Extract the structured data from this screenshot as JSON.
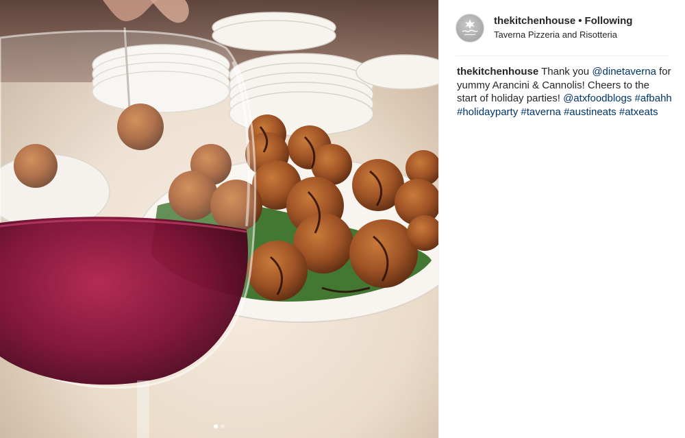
{
  "post": {
    "username": "thekitchenhouse",
    "separator": "•",
    "follow_status": "Following",
    "location": "Taverna Pizzeria and Risotteria"
  },
  "caption": {
    "username": "thekitchenhouse",
    "segments": [
      {
        "text": " Thank you ",
        "type": "text"
      },
      {
        "text": "@dinetaverna",
        "type": "mention"
      },
      {
        "text": " for yummy Arancini & Cannolis! Cheers to the start of holiday parties! ",
        "type": "text"
      },
      {
        "text": "@atxfoodblogs",
        "type": "mention"
      },
      {
        "text": " ",
        "type": "text"
      },
      {
        "text": "#afbahh",
        "type": "hashtag"
      },
      {
        "text": " ",
        "type": "text"
      },
      {
        "text": "#holidayparty",
        "type": "hashtag"
      },
      {
        "text": " ",
        "type": "text"
      },
      {
        "text": "#taverna",
        "type": "hashtag"
      },
      {
        "text": " ",
        "type": "text"
      },
      {
        "text": "#austineats",
        "type": "hashtag"
      },
      {
        "text": " ",
        "type": "text"
      },
      {
        "text": "#atxeats",
        "type": "hashtag"
      }
    ]
  },
  "carousel": {
    "count": 2,
    "active": 0
  },
  "colors": {
    "link": "#003569",
    "text": "#262626",
    "divider": "#efefef"
  },
  "icons": {
    "avatar": "logo-avatar-icon"
  }
}
